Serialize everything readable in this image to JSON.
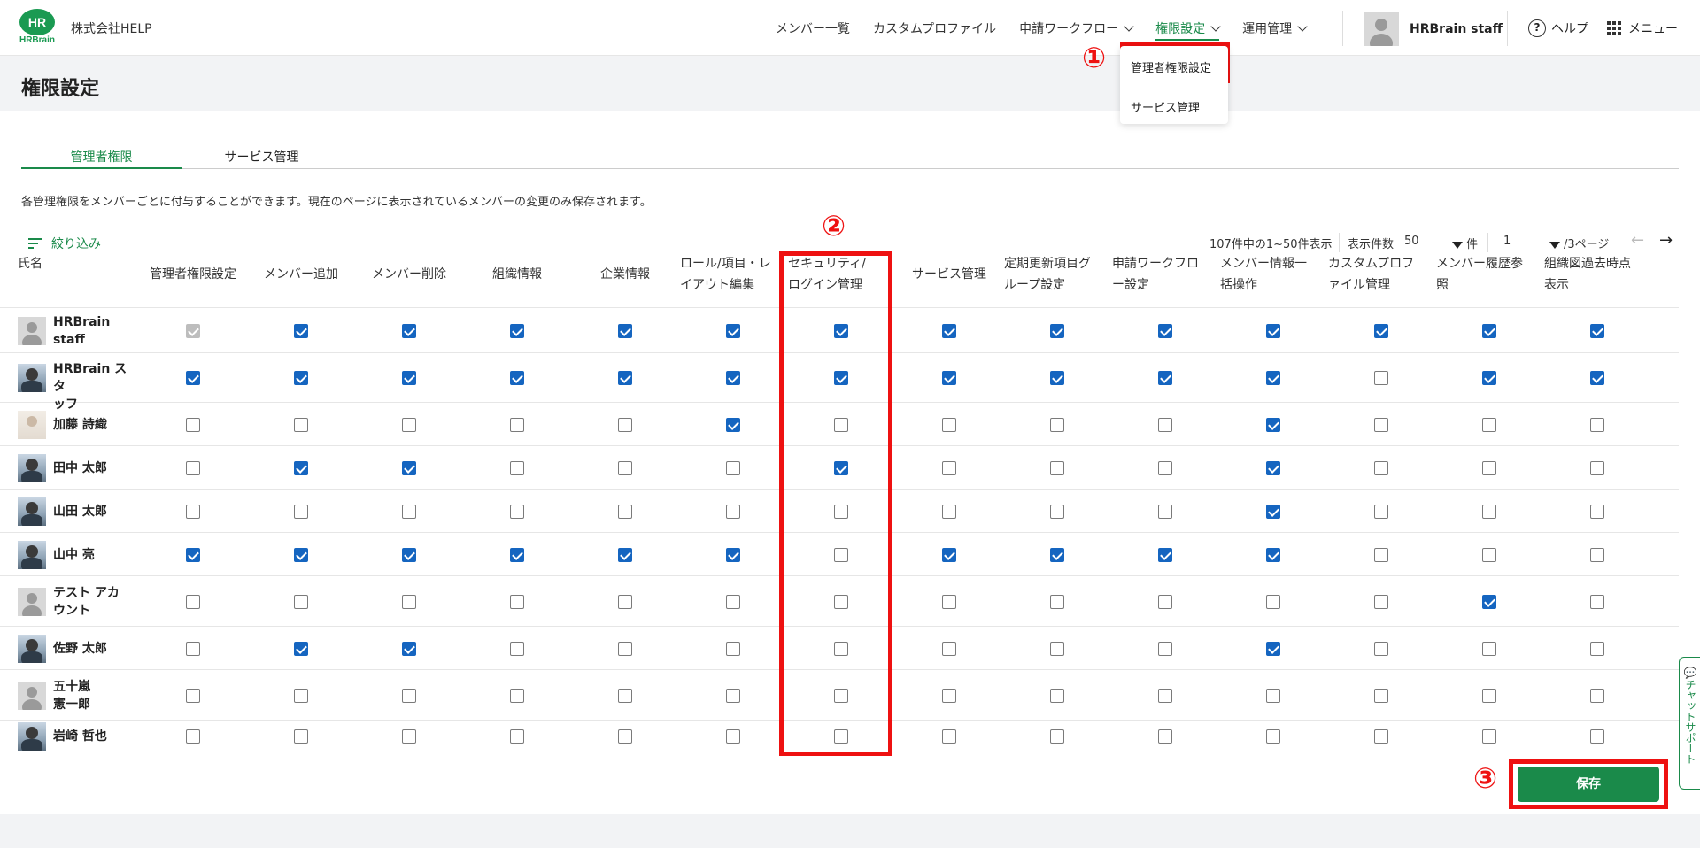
{
  "header": {
    "logo_text": "HR",
    "logo_brand": "HRBrain",
    "company": "株式会社HELP",
    "nav": [
      {
        "label": "メンバー一覧",
        "dropdown": false
      },
      {
        "label": "カスタムプロファイル",
        "dropdown": false
      },
      {
        "label": "申請ワークフロー",
        "dropdown": true
      },
      {
        "label": "権限設定",
        "dropdown": true,
        "active": true
      },
      {
        "label": "運用管理",
        "dropdown": true
      }
    ],
    "user_name": "HRBrain staff",
    "help_label": "ヘルプ",
    "menu_label": "メニュー"
  },
  "dropdown": {
    "items": [
      "管理者権限設定",
      "サービス管理"
    ]
  },
  "page": {
    "title": "権限設定",
    "tabs": [
      "管理者権限",
      "サービス管理"
    ],
    "description": "各管理権限をメンバーごとに付与することができます。現在のページに表示されているメンバーの変更のみ保存されます。",
    "filter_label": "絞り込み"
  },
  "pager": {
    "summary": "107件中の1~50件表示",
    "per_page_label": "表示件数",
    "per_page_value": "50",
    "per_page_unit": "件",
    "page_value": "1",
    "page_total": "/3ページ"
  },
  "table": {
    "name_header": "氏名",
    "columns": [
      "管理者権限設定",
      "メンバー追加",
      "メンバー削除",
      "組織情報",
      "企業情報",
      "ロール/項目・レ\nイアウト編集",
      "セキュリティ/\nログイン管理",
      "サービス管理",
      "定期更新項目グ\nループ設定",
      "申請ワークフロ\nー設定",
      "メンバー情報一\n括操作",
      "カスタムプロフ\nァイル管理",
      "メンバー履歴参\n照",
      "組織図過去時点\n表示"
    ],
    "rows": [
      {
        "name": "HRBrain\nstaff",
        "avatar": "gray",
        "checks": [
          "disabled",
          1,
          1,
          1,
          1,
          1,
          1,
          1,
          1,
          1,
          1,
          1,
          1,
          1
        ]
      },
      {
        "name": "HRBrain スタ\nッフ",
        "avatar": "photo",
        "checks": [
          1,
          1,
          1,
          1,
          1,
          1,
          1,
          1,
          1,
          1,
          1,
          0,
          1,
          1
        ]
      },
      {
        "name": "加藤 詩織",
        "avatar": "light",
        "checks": [
          0,
          0,
          0,
          0,
          0,
          1,
          0,
          0,
          0,
          0,
          1,
          0,
          0,
          0
        ]
      },
      {
        "name": "田中 太郎",
        "avatar": "photo",
        "checks": [
          0,
          1,
          1,
          0,
          0,
          0,
          1,
          0,
          0,
          0,
          1,
          0,
          0,
          0
        ]
      },
      {
        "name": "山田 太郎",
        "avatar": "photo",
        "checks": [
          0,
          0,
          0,
          0,
          0,
          0,
          0,
          0,
          0,
          0,
          1,
          0,
          0,
          0
        ]
      },
      {
        "name": "山中 亮",
        "avatar": "photo",
        "checks": [
          1,
          1,
          1,
          1,
          1,
          1,
          0,
          1,
          1,
          1,
          1,
          0,
          0,
          0
        ]
      },
      {
        "name": "テスト アカ\nウント",
        "avatar": "gray",
        "checks": [
          0,
          0,
          0,
          0,
          0,
          0,
          0,
          0,
          0,
          0,
          0,
          0,
          1,
          0
        ]
      },
      {
        "name": "佐野 太郎",
        "avatar": "photo",
        "checks": [
          0,
          1,
          1,
          0,
          0,
          0,
          0,
          0,
          0,
          0,
          1,
          0,
          0,
          0
        ]
      },
      {
        "name": "五十嵐\n憲一郎",
        "avatar": "gray",
        "checks": [
          0,
          0,
          0,
          0,
          0,
          0,
          0,
          0,
          0,
          0,
          0,
          0,
          0,
          0
        ]
      },
      {
        "name": "岩崎 哲也",
        "avatar": "photo",
        "checks": [
          0,
          0,
          0,
          0,
          0,
          0,
          0,
          0,
          0,
          0,
          0,
          0,
          0,
          0
        ]
      }
    ]
  },
  "save_label": "保存",
  "chat_support": "チャットサポート",
  "annotations": [
    "①",
    "②",
    "③"
  ],
  "colors": {
    "brand_green": "#1a8a4a",
    "checkbox_blue": "#1565c0",
    "annotation_red": "#ee1111"
  }
}
